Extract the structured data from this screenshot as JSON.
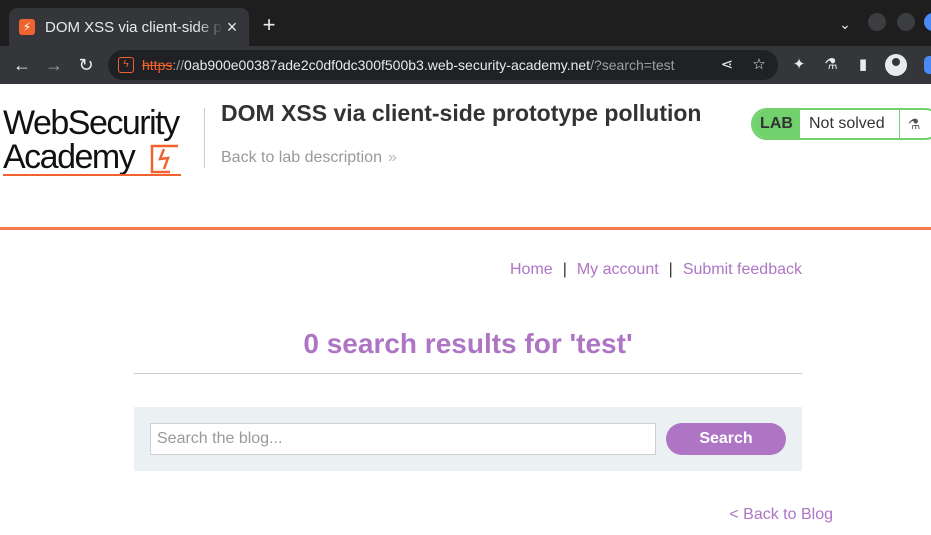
{
  "browser": {
    "tab_title": "DOM XSS via client-side prototype pollution",
    "tab_favicon": "⚡",
    "new_tab_label": "+",
    "url_scheme": "https",
    "url_sep": "://",
    "url_host": "0ab900e00387ade2c0df0dc300f500b3.web-security-academy.net",
    "url_path": "/?search=test",
    "icons": [
      "back-arrow-icon",
      "forward-arrow-icon",
      "reload-icon",
      "share-icon",
      "star-icon",
      "extensions-icon",
      "flask-icon",
      "sidebar-icon",
      "profile-icon"
    ]
  },
  "header": {
    "logo_line1": "WebSecurity",
    "logo_line2": "Academy",
    "lab_title": "DOM XSS via client-side prototype pollution",
    "back_to_description": "Back to lab description",
    "lab_badge": "LAB",
    "lab_status": "Not solved"
  },
  "nav": {
    "home": "Home",
    "my_account": "My account",
    "submit_feedback": "Submit feedback",
    "separator": "|"
  },
  "results": {
    "heading": "0 search results for 'test'"
  },
  "search": {
    "placeholder": "Search the blog...",
    "value": "",
    "button_label": "Search"
  },
  "footer": {
    "back_to_blog": "< Back to Blog"
  },
  "colors": {
    "accent": "#ae75c5",
    "brand_orange": "#f0632e",
    "lab_green": "#70d16d"
  }
}
